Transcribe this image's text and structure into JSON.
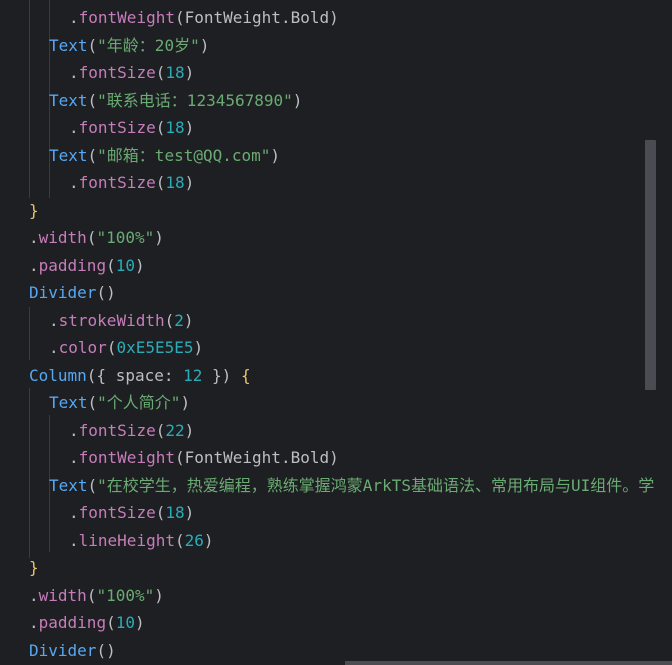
{
  "editor": {
    "lines": [
      {
        "indent": 3,
        "tokens": [
          {
            "c": "t-punc",
            "v": "."
          },
          {
            "c": "t-method2",
            "v": "fontWeight"
          },
          {
            "c": "t-punc",
            "v": "("
          },
          {
            "c": "t-ident",
            "v": "FontWeight"
          },
          {
            "c": "t-punc",
            "v": "."
          },
          {
            "c": "t-ident",
            "v": "Bold"
          },
          {
            "c": "t-punc",
            "v": ")"
          }
        ]
      },
      {
        "indent": 2,
        "tokens": [
          {
            "c": "t-method",
            "v": "Text"
          },
          {
            "c": "t-punc",
            "v": "("
          },
          {
            "c": "t-str",
            "v": "\"年龄：20岁\""
          },
          {
            "c": "t-punc",
            "v": ")"
          }
        ]
      },
      {
        "indent": 3,
        "tokens": [
          {
            "c": "t-punc",
            "v": "."
          },
          {
            "c": "t-method2",
            "v": "fontSize"
          },
          {
            "c": "t-punc",
            "v": "("
          },
          {
            "c": "t-num",
            "v": "18"
          },
          {
            "c": "t-punc",
            "v": ")"
          }
        ]
      },
      {
        "indent": 2,
        "tokens": [
          {
            "c": "t-method",
            "v": "Text"
          },
          {
            "c": "t-punc",
            "v": "("
          },
          {
            "c": "t-str",
            "v": "\"联系电话：1234567890\""
          },
          {
            "c": "t-punc",
            "v": ")"
          }
        ]
      },
      {
        "indent": 3,
        "tokens": [
          {
            "c": "t-punc",
            "v": "."
          },
          {
            "c": "t-method2",
            "v": "fontSize"
          },
          {
            "c": "t-punc",
            "v": "("
          },
          {
            "c": "t-num",
            "v": "18"
          },
          {
            "c": "t-punc",
            "v": ")"
          }
        ]
      },
      {
        "indent": 2,
        "tokens": [
          {
            "c": "t-method",
            "v": "Text"
          },
          {
            "c": "t-punc",
            "v": "("
          },
          {
            "c": "t-str",
            "v": "\"邮箱：test@QQ.com\""
          },
          {
            "c": "t-punc",
            "v": ")"
          }
        ]
      },
      {
        "indent": 3,
        "tokens": [
          {
            "c": "t-punc",
            "v": "."
          },
          {
            "c": "t-method2",
            "v": "fontSize"
          },
          {
            "c": "t-punc",
            "v": "("
          },
          {
            "c": "t-num",
            "v": "18"
          },
          {
            "c": "t-punc",
            "v": ")"
          }
        ]
      },
      {
        "indent": 1,
        "tokens": [
          {
            "c": "t-brace",
            "v": "}"
          }
        ]
      },
      {
        "indent": 1,
        "tokens": [
          {
            "c": "t-punc",
            "v": "."
          },
          {
            "c": "t-method2",
            "v": "width"
          },
          {
            "c": "t-punc",
            "v": "("
          },
          {
            "c": "t-str",
            "v": "\"100%\""
          },
          {
            "c": "t-punc",
            "v": ")"
          }
        ]
      },
      {
        "indent": 1,
        "tokens": [
          {
            "c": "t-punc",
            "v": "."
          },
          {
            "c": "t-method2",
            "v": "padding"
          },
          {
            "c": "t-punc",
            "v": "("
          },
          {
            "c": "t-num",
            "v": "10"
          },
          {
            "c": "t-punc",
            "v": ")"
          }
        ]
      },
      {
        "indent": 1,
        "tokens": [
          {
            "c": "t-method",
            "v": "Divider"
          },
          {
            "c": "t-punc",
            "v": "()"
          }
        ]
      },
      {
        "indent": 2,
        "tokens": [
          {
            "c": "t-punc",
            "v": "."
          },
          {
            "c": "t-method2",
            "v": "strokeWidth"
          },
          {
            "c": "t-punc",
            "v": "("
          },
          {
            "c": "t-num",
            "v": "2"
          },
          {
            "c": "t-punc",
            "v": ")"
          }
        ]
      },
      {
        "indent": 2,
        "tokens": [
          {
            "c": "t-punc",
            "v": "."
          },
          {
            "c": "t-method2",
            "v": "color"
          },
          {
            "c": "t-punc",
            "v": "("
          },
          {
            "c": "t-num",
            "v": "0xE5E5E5"
          },
          {
            "c": "t-punc",
            "v": ")"
          }
        ]
      },
      {
        "indent": 1,
        "tokens": [
          {
            "c": "t-method",
            "v": "Column"
          },
          {
            "c": "t-punc",
            "v": "({ "
          },
          {
            "c": "t-key",
            "v": "space"
          },
          {
            "c": "t-punc",
            "v": ": "
          },
          {
            "c": "t-num",
            "v": "12"
          },
          {
            "c": "t-punc",
            "v": " }) "
          },
          {
            "c": "t-brace",
            "v": "{"
          }
        ]
      },
      {
        "indent": 2,
        "tokens": [
          {
            "c": "t-method",
            "v": "Text"
          },
          {
            "c": "t-punc",
            "v": "("
          },
          {
            "c": "t-str",
            "v": "\"个人简介\""
          },
          {
            "c": "t-punc",
            "v": ")"
          }
        ]
      },
      {
        "indent": 3,
        "tokens": [
          {
            "c": "t-punc",
            "v": "."
          },
          {
            "c": "t-method2",
            "v": "fontSize"
          },
          {
            "c": "t-punc",
            "v": "("
          },
          {
            "c": "t-num",
            "v": "22"
          },
          {
            "c": "t-punc",
            "v": ")"
          }
        ]
      },
      {
        "indent": 3,
        "tokens": [
          {
            "c": "t-punc",
            "v": "."
          },
          {
            "c": "t-method2",
            "v": "fontWeight"
          },
          {
            "c": "t-punc",
            "v": "("
          },
          {
            "c": "t-ident",
            "v": "FontWeight"
          },
          {
            "c": "t-punc",
            "v": "."
          },
          {
            "c": "t-ident",
            "v": "Bold"
          },
          {
            "c": "t-punc",
            "v": ")"
          }
        ]
      },
      {
        "indent": 2,
        "tokens": [
          {
            "c": "t-method",
            "v": "Text"
          },
          {
            "c": "t-punc",
            "v": "("
          },
          {
            "c": "t-str",
            "v": "\"在校学生，热爱编程，熟练掌握鸿蒙ArkTS基础语法、常用布局与UI组件。学"
          }
        ]
      },
      {
        "indent": 3,
        "tokens": [
          {
            "c": "t-punc",
            "v": "."
          },
          {
            "c": "t-method2",
            "v": "fontSize"
          },
          {
            "c": "t-punc",
            "v": "("
          },
          {
            "c": "t-num",
            "v": "18"
          },
          {
            "c": "t-punc",
            "v": ")"
          }
        ]
      },
      {
        "indent": 3,
        "tokens": [
          {
            "c": "t-punc",
            "v": "."
          },
          {
            "c": "t-method2",
            "v": "lineHeight"
          },
          {
            "c": "t-punc",
            "v": "("
          },
          {
            "c": "t-num",
            "v": "26"
          },
          {
            "c": "t-punc",
            "v": ")"
          }
        ]
      },
      {
        "indent": 1,
        "tokens": [
          {
            "c": "t-brace",
            "v": "}"
          }
        ]
      },
      {
        "indent": 1,
        "tokens": [
          {
            "c": "t-punc",
            "v": "."
          },
          {
            "c": "t-method2",
            "v": "width"
          },
          {
            "c": "t-punc",
            "v": "("
          },
          {
            "c": "t-str",
            "v": "\"100%\""
          },
          {
            "c": "t-punc",
            "v": ")"
          }
        ]
      },
      {
        "indent": 1,
        "tokens": [
          {
            "c": "t-punc",
            "v": "."
          },
          {
            "c": "t-method2",
            "v": "padding"
          },
          {
            "c": "t-punc",
            "v": "("
          },
          {
            "c": "t-num",
            "v": "10"
          },
          {
            "c": "t-punc",
            "v": ")"
          }
        ]
      },
      {
        "indent": 1,
        "tokens": [
          {
            "c": "t-method",
            "v": "Divider"
          },
          {
            "c": "t-punc",
            "v": "()"
          }
        ]
      }
    ]
  },
  "colors": {
    "background": "#1e1f22",
    "method": "#56a8f5",
    "property": "#c77dbb",
    "string": "#6aab73",
    "number": "#2aacb8",
    "brace": "#e8c46d",
    "text": "#bcbec4"
  }
}
